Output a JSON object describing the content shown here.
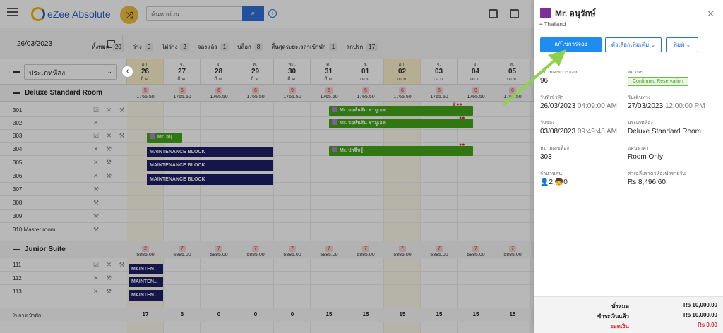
{
  "app": {
    "name": "eZee Absolute",
    "search_placeholder": "ค้นหาด่วน"
  },
  "filterbar": {
    "date": "26/03/2023",
    "counts": [
      {
        "label": "ทั้งหมด",
        "value": "20"
      },
      {
        "label": "ว่าง",
        "value": "9"
      },
      {
        "label": "ไม่ว่าง",
        "value": "2"
      },
      {
        "label": "จองแล้ว",
        "value": "1"
      },
      {
        "label": "บล็อก",
        "value": "8"
      },
      {
        "label": "สิ้นสุดระยะเวลาเข้าพัก",
        "value": "1"
      },
      {
        "label": "สกปรก",
        "value": "17"
      }
    ]
  },
  "grid": {
    "roomtype_select": "ประเภทห้อง",
    "dates": [
      {
        "dow": "อา.",
        "day": "26",
        "mon": "มี.ค."
      },
      {
        "dow": "จ.",
        "day": "27",
        "mon": "มี.ค."
      },
      {
        "dow": "อ.",
        "day": "28",
        "mon": "มี.ค."
      },
      {
        "dow": "พ.",
        "day": "29",
        "mon": "มี.ค."
      },
      {
        "dow": "พฤ.",
        "day": "30",
        "mon": "มี.ค."
      },
      {
        "dow": "ศ.",
        "day": "31",
        "mon": "มี.ค."
      },
      {
        "dow": "ส.",
        "day": "01",
        "mon": "เม.ย."
      },
      {
        "dow": "อา.",
        "day": "02",
        "mon": "เม.ย."
      },
      {
        "dow": "จ.",
        "day": "03",
        "mon": "เม.ย."
      },
      {
        "dow": "อ.",
        "day": "04",
        "mon": "เม.ย."
      },
      {
        "dow": "พ.",
        "day": "05",
        "mon": "เม.ย."
      }
    ],
    "sections": [
      {
        "name": "Deluxe Standard Room",
        "avail": [
          "5",
          "6",
          "6",
          "6",
          "9",
          "6",
          "5",
          "6",
          "6",
          "9",
          "6"
        ],
        "rates": [
          "1765.50",
          "1765.50",
          "1765.50",
          "1765.50",
          "1765.50",
          "1765.50",
          "1765.50",
          "1765.50",
          "1765.50",
          "1765.50",
          "1765.50"
        ],
        "rooms": [
          "301",
          "302",
          "303",
          "304",
          "305",
          "306",
          "307",
          "308",
          "309",
          "310 Master room"
        ]
      },
      {
        "name": "Junior Suite",
        "avail": [
          "2",
          "7",
          "7",
          "7",
          "7",
          "7",
          "7",
          "7",
          "7",
          "7",
          "7"
        ],
        "rates": [
          "5885.00",
          "5885.00",
          "5885.00",
          "5885.00",
          "5885.00",
          "5885.00",
          "5885.00",
          "5885.00",
          "5885.00",
          "5885.00",
          "5885.00"
        ],
        "rooms": [
          "111",
          "112",
          "113"
        ]
      }
    ],
    "bookings": {
      "b1": "Mr. จอห์นสัน ชามูเอล",
      "b2": "Mr. จอห์นสัน ชามูเอล",
      "b3": "Mr. อนุ...",
      "b4": "Mr. ปาจีชรู้",
      "m1": "MAINTENANCE BLOCK",
      "m2": "MAINTENANCE BLOCK",
      "m3": "MAINTENANCE BLOCK",
      "m4": "MAINTEN...",
      "m5": "MAINTEN...",
      "m6": "MAINTEN..."
    },
    "footer_label": "% การเข้าพัก",
    "footer_values": [
      "17",
      "6",
      "0",
      "0",
      "0",
      "15",
      "15",
      "15",
      "15",
      "15",
      "15"
    ]
  },
  "panel": {
    "guest_name": "Mr. อนุรักษ์",
    "country": "Thailand",
    "edit_button": "แก้ไขการจอง",
    "more_options": "ตัวเลือกเพิ่มเติม",
    "print": "พิมพ์",
    "fields": {
      "res_no_label": "หมายเลขการจอง",
      "res_no": "96",
      "status_label": "สถานะ",
      "status": "Confirmed Reservation",
      "arrival_label": "วันที่เข้าพัก",
      "arrival_date": "26/03/2023",
      "arrival_time": "04:09:00 AM",
      "departure_label": "วันเดินทาง",
      "departure_date": "27/03/2023",
      "departure_time": "12:00:00 PM",
      "booked_label": "วันจอง",
      "booked_date": "03/08/2023",
      "booked_time": "09:49:48 AM",
      "roomtype_label": "ประเภทห้อง",
      "roomtype": "Deluxe Standard Room",
      "room_label": "หมายเลขห้อง",
      "room": "303",
      "plan_label": "แผนราคา",
      "plan": "Room Only",
      "pax_label": "จำนวนคน",
      "adults": "2",
      "children": "0",
      "avg_label": "ค่าเฉลี่ยราคาห้องพักรายวัน",
      "avg": "Rs 8,496.60"
    },
    "totals": [
      {
        "label": "ทั้งหมด",
        "value": "Rs 10,000.00"
      },
      {
        "label": "ชำระเงินแล้ว",
        "value": "Rs 10,000.00"
      },
      {
        "label": "ยอดเงิน",
        "value": "Rs 0.00"
      }
    ],
    "balance_color": "#d32f2f"
  }
}
